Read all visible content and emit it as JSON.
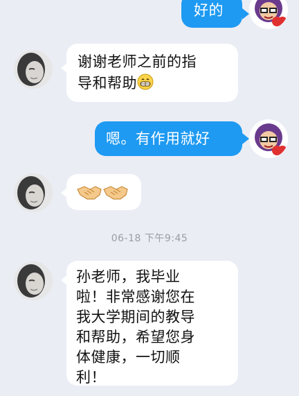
{
  "messages": [
    {
      "side": "out",
      "text": "好的"
    },
    {
      "side": "in",
      "line1": "谢谢老师之前的指",
      "line2": "导和帮助",
      "emoji": "grin-face-icon"
    },
    {
      "side": "out",
      "text": "嗯。有作用就好"
    },
    {
      "side": "in",
      "emoji": "handshake-icon",
      "count": 2
    },
    {
      "side": "in",
      "lines": [
        "孙老师，我毕业",
        "啦！非常感谢您在",
        "我大学期间的教导",
        "和帮助，希望您身",
        "体健康，一切顺",
        "利！"
      ]
    }
  ],
  "timestamp": "06-18 下午9:45",
  "colors": {
    "background": "#ebedf5",
    "outgoing_bubble": "#1e9af2",
    "incoming_bubble": "#ffffff"
  }
}
